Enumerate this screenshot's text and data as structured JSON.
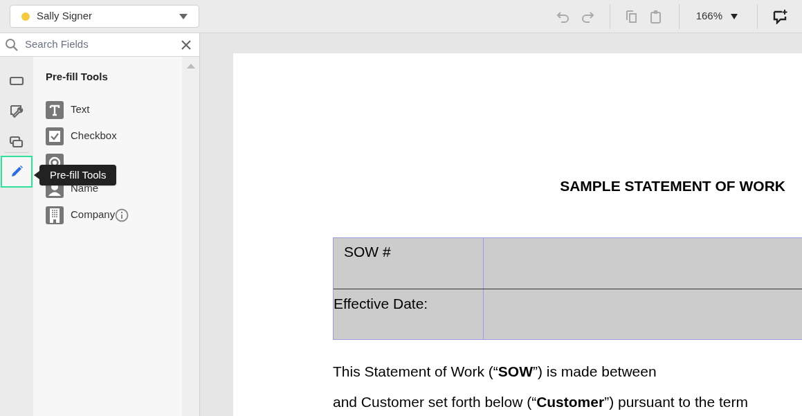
{
  "signer": {
    "name": "Sally Signer",
    "color": "#f5c842"
  },
  "toolbar": {
    "zoom": "166%"
  },
  "search": {
    "placeholder": "Search Fields"
  },
  "rail": [
    {
      "kind": "field",
      "selected": false
    },
    {
      "kind": "tools",
      "selected": false
    },
    {
      "kind": "layers",
      "selected": false
    },
    {
      "kind": "prefill",
      "selected": true
    }
  ],
  "panel": {
    "title": "Pre-fill Tools",
    "items": [
      {
        "kind": "text",
        "label": "Text",
        "info": false
      },
      {
        "kind": "checkbox",
        "label": "Checkbox",
        "info": false
      },
      {
        "kind": "radio",
        "info": false
      },
      {
        "kind": "name",
        "label": "Name",
        "info": false
      },
      {
        "kind": "company",
        "label": "Company",
        "info": true
      }
    ]
  },
  "tooltip": "Pre-fill Tools",
  "document": {
    "title": "SAMPLE STATEMENT OF WORK",
    "table": [
      {
        "label": "SOW #"
      },
      {
        "label": "Effective Date:"
      }
    ],
    "paragraphs": [
      "This Statement of Work (“**SOW**”) is made between",
      "and Customer set forth below (“**Customer**”) pursuant to the term"
    ]
  }
}
